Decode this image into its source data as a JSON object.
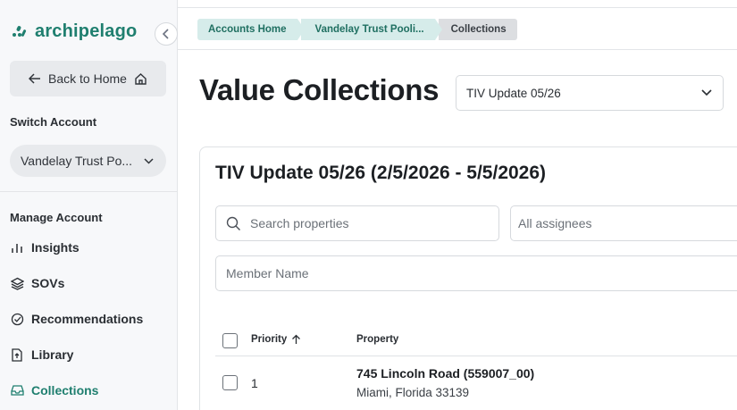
{
  "app": {
    "logo_text": "archipelago",
    "brand_color": "#1f7f6f"
  },
  "sidebar": {
    "back_label": "Back to Home",
    "switch_account_label": "Switch Account",
    "account_value": "Vandelay Trust Po...",
    "manage_account_label": "Manage Account",
    "items": [
      {
        "label": "Insights",
        "icon": "bar-chart-icon"
      },
      {
        "label": "SOVs",
        "icon": "layers-icon"
      },
      {
        "label": "Recommendations",
        "icon": "check-circle-icon"
      },
      {
        "label": "Library",
        "icon": "file-upload-icon"
      },
      {
        "label": "Collections",
        "icon": "inbox-icon",
        "active": true
      }
    ]
  },
  "breadcrumb": {
    "items": [
      "Accounts Home",
      "Vandelay Trust Pooli...",
      "Collections"
    ]
  },
  "main": {
    "title": "Value Collections",
    "collection_select": "TIV Update 05/26",
    "card": {
      "title": "TIV Update 05/26 (2/5/2026 - 5/5/2026)",
      "search_placeholder": "Search properties",
      "assignees_placeholder": "All assignees",
      "member_placeholder": "Member Name",
      "columns": {
        "priority": "Priority",
        "property": "Property"
      },
      "rows": [
        {
          "priority": "1",
          "name": "745 Lincoln Road (559007_00)",
          "address": "Miami, Florida 33139"
        }
      ]
    }
  }
}
